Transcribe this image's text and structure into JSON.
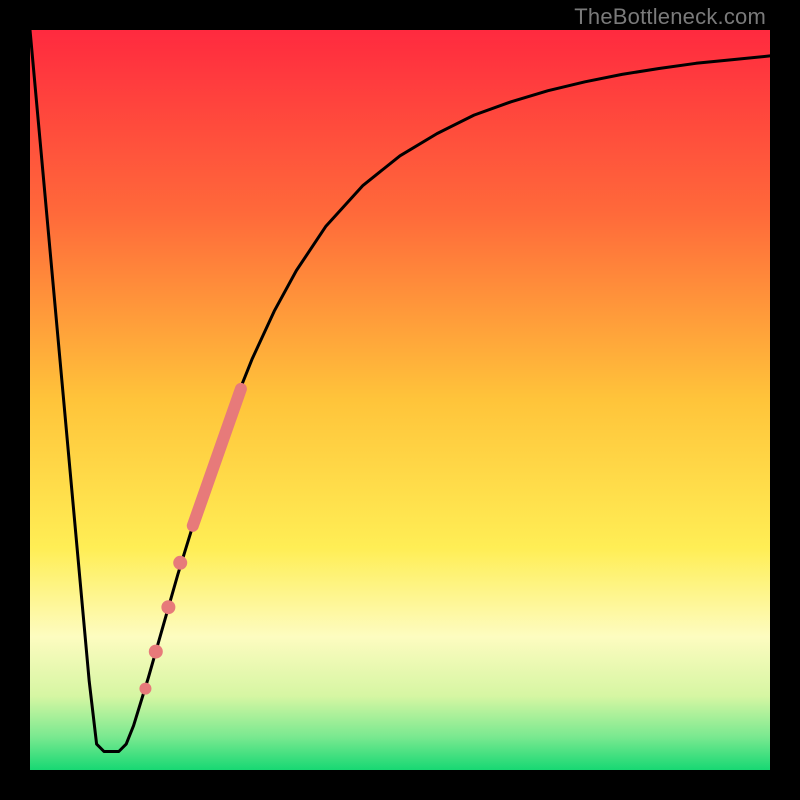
{
  "watermark": "TheBottleneck.com",
  "chart_data": {
    "type": "line",
    "title": "",
    "xlabel": "",
    "ylabel": "",
    "xlim": [
      0,
      100
    ],
    "ylim": [
      0,
      100
    ],
    "background_gradient": {
      "stops": [
        {
          "offset": 0.0,
          "color": "#ff2a3f"
        },
        {
          "offset": 0.25,
          "color": "#ff6a3a"
        },
        {
          "offset": 0.5,
          "color": "#ffc43a"
        },
        {
          "offset": 0.7,
          "color": "#ffee55"
        },
        {
          "offset": 0.82,
          "color": "#fdfcc0"
        },
        {
          "offset": 0.9,
          "color": "#d6f6a3"
        },
        {
          "offset": 0.955,
          "color": "#7ae990"
        },
        {
          "offset": 1.0,
          "color": "#17d873"
        }
      ]
    },
    "series": [
      {
        "name": "bottleneck-curve",
        "color": "#000000",
        "points": [
          {
            "x": 0.0,
            "y": 100.0
          },
          {
            "x": 2.0,
            "y": 78.0
          },
          {
            "x": 4.0,
            "y": 56.0
          },
          {
            "x": 6.0,
            "y": 34.0
          },
          {
            "x": 8.0,
            "y": 12.0
          },
          {
            "x": 9.0,
            "y": 3.5
          },
          {
            "x": 10.0,
            "y": 2.5
          },
          {
            "x": 11.0,
            "y": 2.5
          },
          {
            "x": 12.0,
            "y": 2.5
          },
          {
            "x": 13.0,
            "y": 3.5
          },
          {
            "x": 14.0,
            "y": 6.0
          },
          {
            "x": 16.0,
            "y": 12.5
          },
          {
            "x": 18.0,
            "y": 19.5
          },
          {
            "x": 20.0,
            "y": 26.5
          },
          {
            "x": 22.0,
            "y": 33.0
          },
          {
            "x": 24.0,
            "y": 39.0
          },
          {
            "x": 26.0,
            "y": 45.0
          },
          {
            "x": 28.0,
            "y": 50.5
          },
          {
            "x": 30.0,
            "y": 55.5
          },
          {
            "x": 33.0,
            "y": 62.0
          },
          {
            "x": 36.0,
            "y": 67.5
          },
          {
            "x": 40.0,
            "y": 73.5
          },
          {
            "x": 45.0,
            "y": 79.0
          },
          {
            "x": 50.0,
            "y": 83.0
          },
          {
            "x": 55.0,
            "y": 86.0
          },
          {
            "x": 60.0,
            "y": 88.5
          },
          {
            "x": 65.0,
            "y": 90.3
          },
          {
            "x": 70.0,
            "y": 91.8
          },
          {
            "x": 75.0,
            "y": 93.0
          },
          {
            "x": 80.0,
            "y": 94.0
          },
          {
            "x": 85.0,
            "y": 94.8
          },
          {
            "x": 90.0,
            "y": 95.5
          },
          {
            "x": 95.0,
            "y": 96.0
          },
          {
            "x": 100.0,
            "y": 96.5
          }
        ]
      },
      {
        "name": "highlight-segment",
        "color": "#e77a7a",
        "stroke_width": 12,
        "points": [
          {
            "x": 22.0,
            "y": 33.0
          },
          {
            "x": 28.5,
            "y": 51.5
          }
        ]
      }
    ],
    "markers": [
      {
        "x": 20.3,
        "y": 28.0,
        "r": 7,
        "color": "#e77a7a"
      },
      {
        "x": 18.7,
        "y": 22.0,
        "r": 7,
        "color": "#e77a7a"
      },
      {
        "x": 17.0,
        "y": 16.0,
        "r": 7,
        "color": "#e77a7a"
      },
      {
        "x": 15.6,
        "y": 11.0,
        "r": 6,
        "color": "#e77a7a"
      }
    ]
  }
}
